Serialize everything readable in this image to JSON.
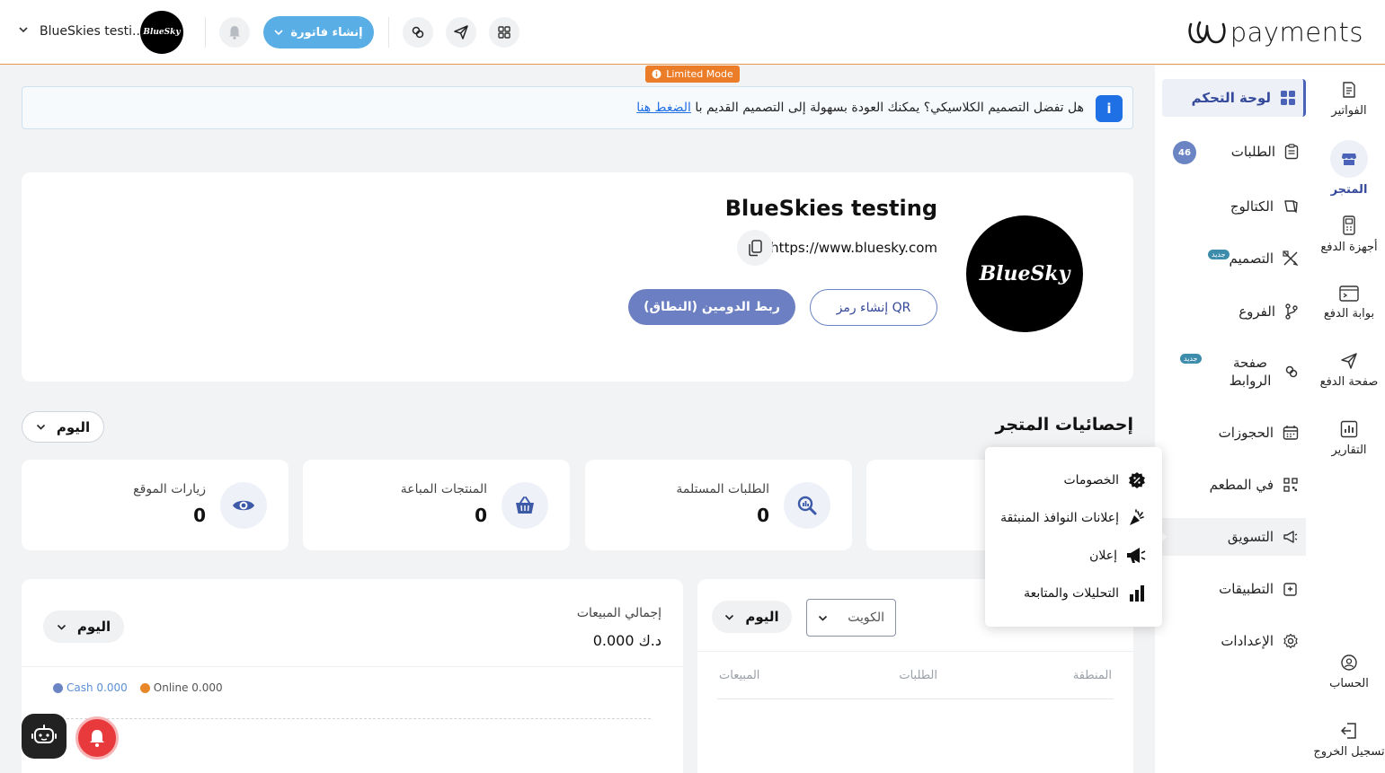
{
  "topbar": {
    "logo_text": "payments",
    "create_invoice_label": "إنشاء فاتورة",
    "store_name": "BlueSkies testi...",
    "brand_avatar_text": "BlueSky",
    "icons": [
      "qr-scan-icon",
      "send-icon",
      "link-icon",
      "bell-icon",
      "chevron-down-icon"
    ]
  },
  "limited_mode_label": "Limited Mode",
  "banner": {
    "text": "هل تفضل التصميم الكلاسيكي؟ يمكنك العودة بسهولة إلى التصميم القديم با",
    "link_text": "الضغط هنا"
  },
  "store": {
    "title": "BlueSkies testing",
    "url": "https://www.bluesky.com",
    "logo_text": "BlueSky",
    "qr_button": "إنشاء رمز QR",
    "domain_button": "ربط الدومين (النطاق)"
  },
  "stats": {
    "title": "إحصائيات المتجر",
    "period_select": "اليوم",
    "cards": [
      {
        "label": "الطلبات المستلمة",
        "value": "0",
        "icon": "search-chart-icon"
      },
      {
        "label": "المنتجات المباعة",
        "value": "0",
        "icon": "basket-icon"
      },
      {
        "label": "زيارات الموقع",
        "value": "0",
        "icon": "eye-icon"
      }
    ]
  },
  "sales": {
    "title": "إجمالي المبيعات",
    "total": "0.000 د.ك",
    "period_select": "اليوم",
    "legend": {
      "online": "Online 0.000",
      "cash": "Cash 0.000",
      "online_color": "#e8872a",
      "cash_color": "#6b84c4"
    }
  },
  "regions": {
    "country_select": "الكويت",
    "period_select": "اليوم",
    "columns": [
      "المنطقة",
      "الطلبات",
      "المبيعات"
    ]
  },
  "sidebar": {
    "items": [
      {
        "label": "لوحة التحكم",
        "icon": "dashboard-icon",
        "active": true
      },
      {
        "label": "الطلبات",
        "icon": "clipboard-icon",
        "count": "46"
      },
      {
        "label": "الكتالوج",
        "icon": "catalog-icon"
      },
      {
        "label": "التصميم",
        "icon": "design-icon",
        "badge": "جديد"
      },
      {
        "label": "الفروع",
        "icon": "branch-icon"
      },
      {
        "label": "صفحة الروابط",
        "icon": "links-icon",
        "badge": "جديد"
      },
      {
        "label": "الحجوزات",
        "icon": "calendar-icon"
      },
      {
        "label": "في المطعم",
        "icon": "qr-icon"
      },
      {
        "label": "التسويق",
        "icon": "megaphone-icon"
      },
      {
        "label": "التطبيقات",
        "icon": "apps-icon"
      },
      {
        "label": "الإعدادات",
        "icon": "settings-icon"
      }
    ]
  },
  "rail": {
    "items": [
      {
        "label": "الفواتير",
        "icon": "invoice-icon"
      },
      {
        "label": "المتجر",
        "icon": "store-icon",
        "active": true
      },
      {
        "label": "أجهزة الدفع",
        "icon": "pos-device-icon"
      },
      {
        "label": "بوابة الدفع",
        "icon": "gateway-icon"
      },
      {
        "label": "صفحة الدفع",
        "icon": "send-icon"
      },
      {
        "label": "التقارير",
        "icon": "reports-icon"
      },
      {
        "label": "الحساب",
        "icon": "account-icon"
      },
      {
        "label": "تسجيل الخروج",
        "icon": "logout-icon"
      }
    ]
  },
  "marketing_menu": {
    "items": [
      {
        "label": "الخصومات",
        "icon": "discount-icon"
      },
      {
        "label": "إعلانات النوافذ المنبثقة",
        "icon": "popup-ads-icon"
      },
      {
        "label": "إعلان",
        "icon": "megaphone-icon"
      },
      {
        "label": "التحليلات والمتابعة",
        "icon": "analytics-icon"
      }
    ]
  }
}
